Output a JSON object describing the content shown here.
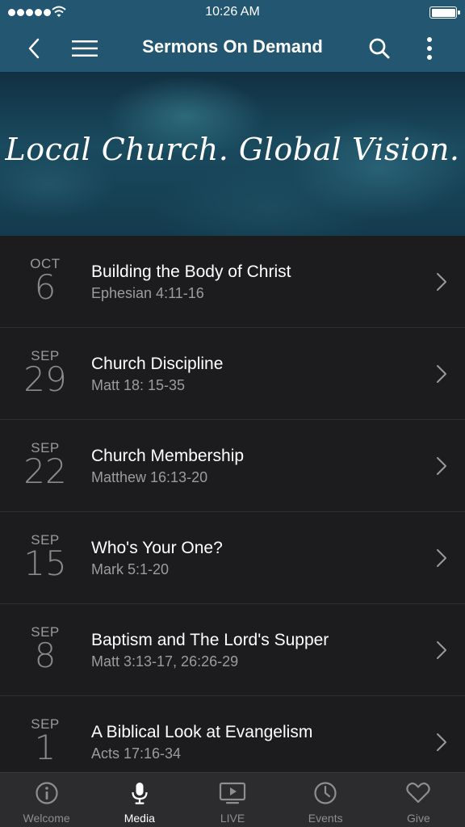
{
  "status_bar": {
    "time": "10:26 AM"
  },
  "header": {
    "title": "Sermons On Demand"
  },
  "banner": {
    "text": "Local Church. Global Vision."
  },
  "sermons": [
    {
      "month": "OCT",
      "day": "6",
      "title": "Building the Body of Christ",
      "reference": "Ephesian 4:11-16"
    },
    {
      "month": "SEP",
      "day": "29",
      "title": "Church Discipline",
      "reference": "Matt 18: 15-35"
    },
    {
      "month": "SEP",
      "day": "22",
      "title": "Church Membership",
      "reference": "Matthew 16:13-20"
    },
    {
      "month": "SEP",
      "day": "15",
      "title": "Who's Your One?",
      "reference": "Mark 5:1-20"
    },
    {
      "month": "SEP",
      "day": "8",
      "title": "Baptism and The Lord's Supper",
      "reference": "Matt 3:13-17, 26:26-29"
    },
    {
      "month": "SEP",
      "day": "1",
      "title": "A Biblical Look at Evangelism",
      "reference": "Acts 17:16-34"
    }
  ],
  "tabs": [
    {
      "label": "Welcome",
      "icon": "info-icon",
      "active": false
    },
    {
      "label": "Media",
      "icon": "microphone-icon",
      "active": true
    },
    {
      "label": "LIVE",
      "icon": "live-tv-icon",
      "active": false
    },
    {
      "label": "Events",
      "icon": "clock-icon",
      "active": false
    },
    {
      "label": "Give",
      "icon": "heart-icon",
      "active": false
    }
  ],
  "colors": {
    "header": "#235670",
    "list_bg": "#1c1c1e",
    "tabbar_bg": "#2c2c2e"
  }
}
